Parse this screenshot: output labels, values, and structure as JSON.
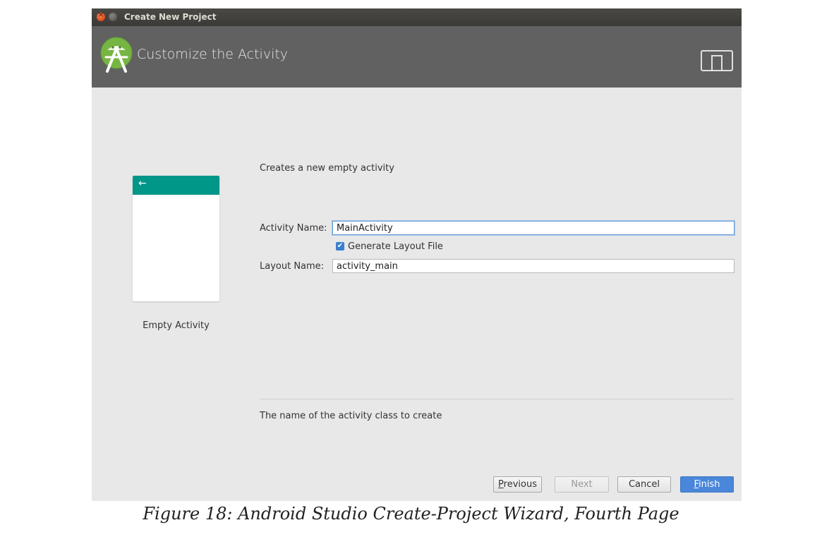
{
  "window": {
    "title": "Create New Project"
  },
  "header": {
    "title": "Customize the Activity"
  },
  "template": {
    "name": "Empty Activity",
    "back_glyph": "←",
    "toolbar_color": "#009688"
  },
  "form": {
    "description": "Creates a new empty activity",
    "activity_name_label": "Activity Name:",
    "activity_name_value": "MainActivity",
    "generate_layout_label": "Generate Layout File",
    "generate_layout_checked": true,
    "layout_name_label": "Layout Name:",
    "layout_name_value": "activity_main"
  },
  "help_text": "The name of the activity class to create",
  "buttons": {
    "previous_mnemonic": "P",
    "previous_rest": "revious",
    "next": "Next",
    "cancel": "Cancel",
    "finish_mnemonic": "F",
    "finish_rest": "inish"
  },
  "caption": "Figure 18: Android Studio Create-Project Wizard, Fourth Page",
  "colors": {
    "accent": "#4a86d9",
    "header_bg": "#616161"
  }
}
